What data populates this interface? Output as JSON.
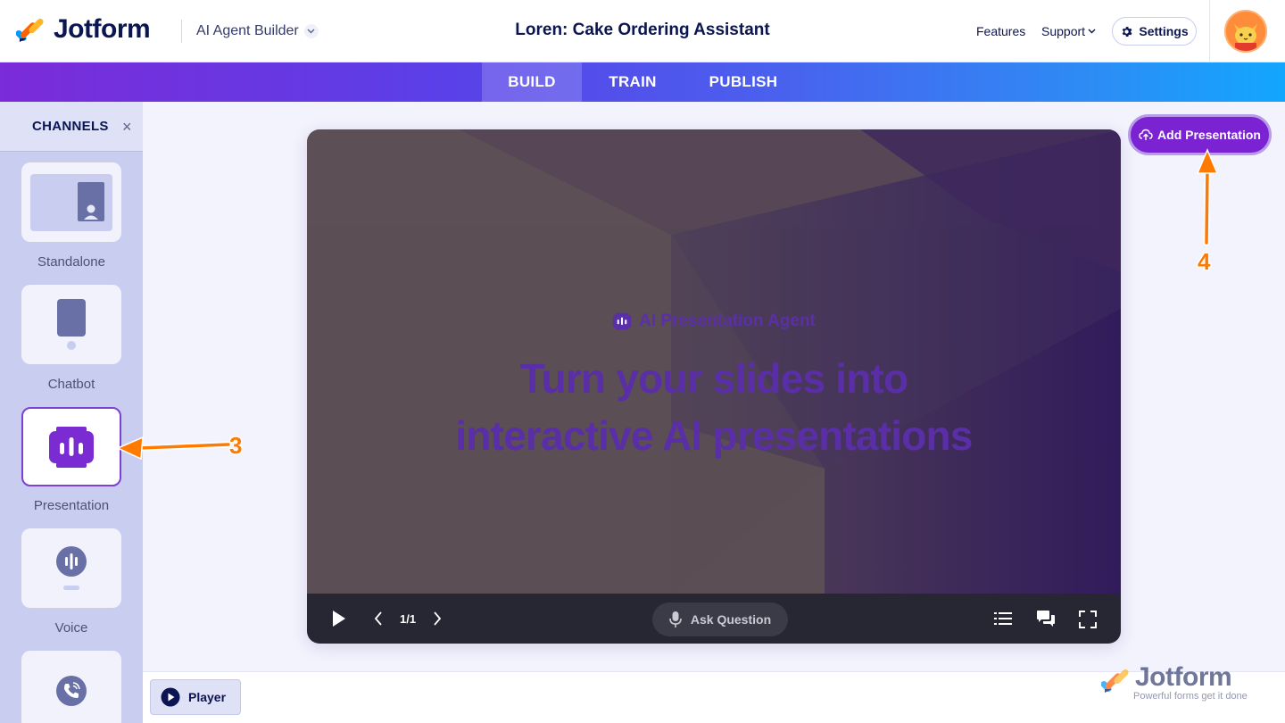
{
  "header": {
    "logo_text": "Jotform",
    "product_name": "AI Agent Builder",
    "agent_title": "Loren: Cake Ordering Assistant",
    "nav_features": "Features",
    "nav_support": "Support",
    "settings_label": "Settings"
  },
  "tabs": [
    {
      "label": "BUILD",
      "active": true
    },
    {
      "label": "TRAIN",
      "active": false
    },
    {
      "label": "PUBLISH",
      "active": false
    }
  ],
  "sidebar": {
    "title": "CHANNELS",
    "close_glyph": "×",
    "channels": [
      {
        "label": "Standalone",
        "icon": "standalone-icon",
        "active": false
      },
      {
        "label": "Chatbot",
        "icon": "chatbot-icon",
        "active": false
      },
      {
        "label": "Presentation",
        "icon": "presentation-icon",
        "active": true
      },
      {
        "label": "Voice",
        "icon": "voice-icon",
        "active": false
      },
      {
        "label": "",
        "icon": "phone-icon",
        "active": false
      }
    ]
  },
  "slide": {
    "badge": "AI Presentation Agent",
    "heading_line1": "Turn your slides into",
    "heading_line2": "interactive AI presentations",
    "page_indicator": "1/1",
    "ask_question": "Ask Question"
  },
  "actions": {
    "add_presentation": "Add Presentation",
    "player": "Player"
  },
  "watermark": {
    "logo_text": "Jotform",
    "tagline": "Powerful forms get it done"
  },
  "annotations": {
    "step3": "3",
    "step4": "4"
  },
  "colors": {
    "accent_purple": "#7b22d2",
    "annotation_orange": "#ff7a00",
    "brand_navy": "#0a1551"
  }
}
